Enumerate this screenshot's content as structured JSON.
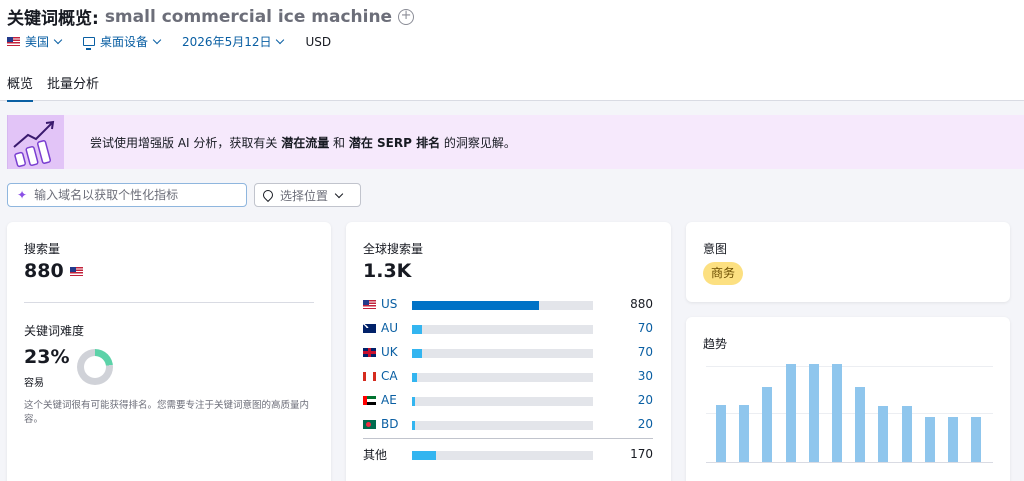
{
  "header": {
    "title_label": "关键词概览:",
    "keyword": "small commercial ice machine",
    "add_icon": "plus-circle-icon",
    "filters": {
      "country": "美国",
      "device": "桌面设备",
      "date": "2026年5月12日",
      "currency": "USD"
    },
    "tabs": [
      {
        "label": "概览",
        "active": true
      },
      {
        "label": "批量分析",
        "active": false
      }
    ]
  },
  "banner": {
    "text_1": "尝试使用增强版 AI 分析，获取有关 ",
    "bold_1": "潜在流量",
    "text_2": " 和 ",
    "bold_2": "潜在 SERP 排名",
    "text_3": " 的洞察见解。"
  },
  "domain_input": {
    "placeholder": "输入域名以获取个性化指标"
  },
  "location_select": {
    "label": "选择位置"
  },
  "volume_card": {
    "label": "搜索量",
    "value": "880",
    "difficulty_label": "关键词难度",
    "difficulty_value": "23%",
    "difficulty_percent": 23,
    "difficulty_level": "容易",
    "difficulty_desc": "这个关键词很有可能获得排名。您需要专注于关键词意图的高质量内容。"
  },
  "global_card": {
    "label": "全球搜索量",
    "value": "1.3K",
    "countries": [
      {
        "code": "US",
        "value": "880",
        "fraction": 0.7
      },
      {
        "code": "AU",
        "value": "70",
        "fraction": 0.055
      },
      {
        "code": "UK",
        "value": "70",
        "fraction": 0.055
      },
      {
        "code": "CA",
        "value": "30",
        "fraction": 0.025
      },
      {
        "code": "AE",
        "value": "20",
        "fraction": 0.015
      },
      {
        "code": "BD",
        "value": "20",
        "fraction": 0.015
      }
    ],
    "others": {
      "label": "其他",
      "value": "170",
      "fraction": 0.135
    }
  },
  "intent_card": {
    "label": "意图",
    "badge": "商务"
  },
  "trend_card": {
    "label": "趋势",
    "values": [
      0.58,
      0.58,
      0.77,
      1.0,
      1.0,
      1.0,
      0.77,
      0.57,
      0.57,
      0.46,
      0.46,
      0.46
    ]
  },
  "colors": {
    "accent": "#0a5fa3",
    "bar_us": "#0072c6",
    "bar_other": "#33b5f0",
    "trend_bar": "#8fc6ed",
    "donut_fill": "#5cd2a8",
    "badge_bg": "#fce081",
    "banner_bg": "#f6e9fc"
  }
}
